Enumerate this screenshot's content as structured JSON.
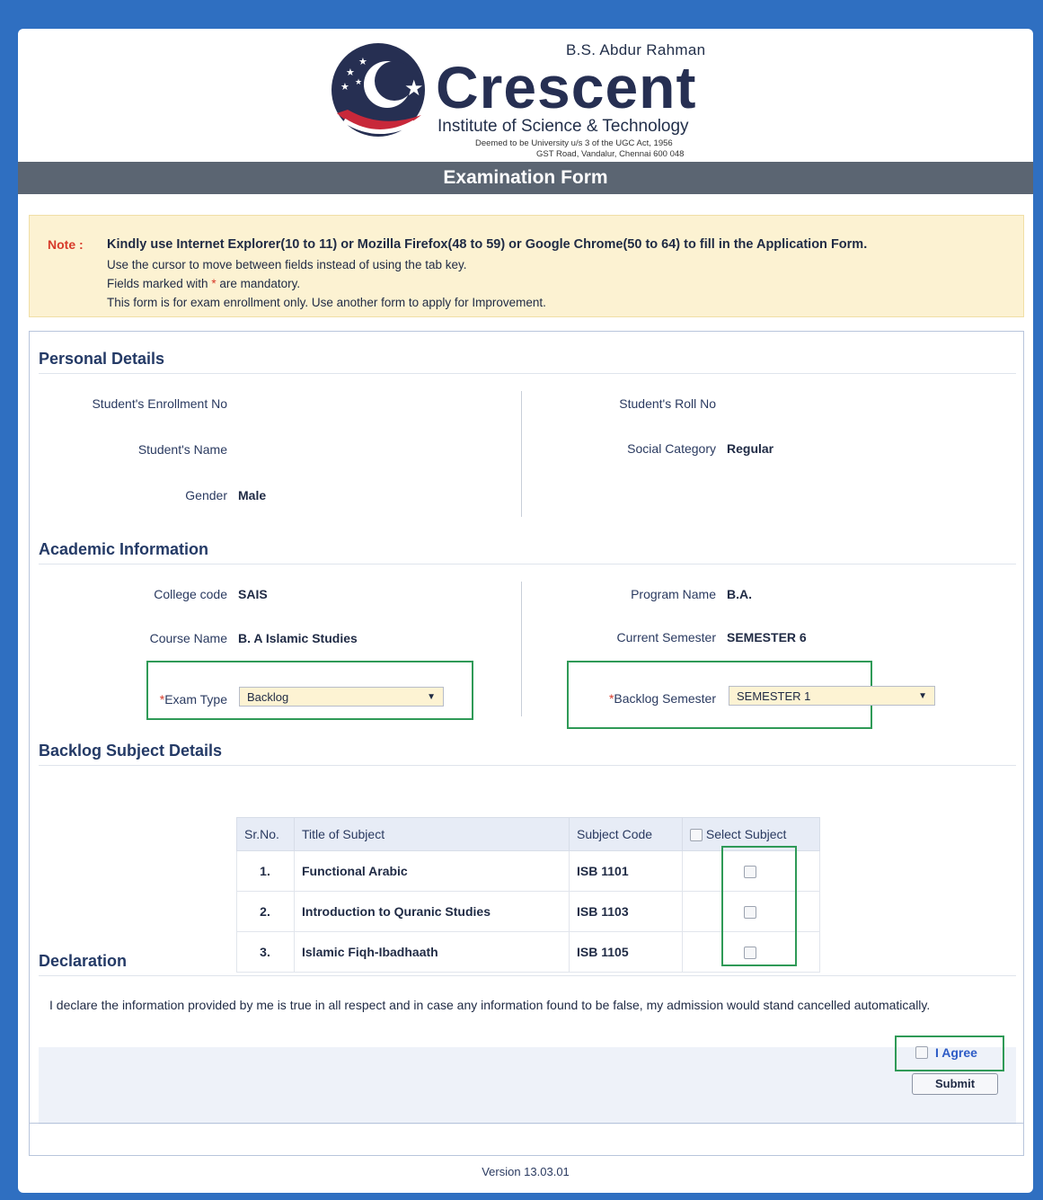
{
  "header": {
    "brand_top": "B.S. Abdur Rahman",
    "brand_name": "Crescent",
    "brand_sub": "Institute of Science & Technology",
    "brand_small1": "Deemed to be University u/s 3 of the UGC Act, 1956",
    "brand_small2": "GST Road, Vandalur, Chennai 600 048",
    "title": "Examination Form"
  },
  "note": {
    "label": "Note :",
    "lines": [
      "Kindly use Internet Explorer(10 to 11) or Mozilla Firefox(48 to 59) or Google Chrome(50 to 64) to fill in the Application Form.",
      "Use the cursor to move between fields instead of using the tab key.",
      "Fields marked with",
      "are mandatory.",
      "This form is for exam enrollment only. Use another form to apply for Improvement."
    ],
    "star": "*"
  },
  "personal": {
    "title": "Personal Details",
    "enrollment_label": "Student's Enrollment No",
    "enrollment_value": "",
    "name_label": "Student's Name",
    "name_value": "",
    "gender_label": "Gender",
    "gender_value": "Male",
    "roll_label": "Student's Roll No",
    "roll_value": "",
    "category_label": "Social Category",
    "category_value": "Regular"
  },
  "academic": {
    "title": "Academic Information",
    "college_label": "College code",
    "college_value": "SAIS",
    "course_label": "Course Name",
    "course_value": "B. A Islamic Studies",
    "program_label": "Program Name",
    "program_value": "B.A.",
    "semester_label": "Current Semester",
    "semester_value": "SEMESTER 6",
    "exam_type_label": "Exam Type",
    "exam_type_value": "Backlog",
    "backlog_sem_label": "Backlog Semester",
    "backlog_sem_value": "SEMESTER 1",
    "star": "*"
  },
  "backlog": {
    "title": "Backlog Subject Details",
    "headers": [
      "Sr.No.",
      "Title of Subject",
      "Subject Code",
      "Select Subject"
    ],
    "rows": [
      {
        "sr": "1.",
        "title": "Functional Arabic",
        "code": "ISB 1101"
      },
      {
        "sr": "2.",
        "title": "Introduction to Quranic Studies",
        "code": "ISB 1103"
      },
      {
        "sr": "3.",
        "title": "Islamic Fiqh-Ibadhaath",
        "code": "ISB 1105"
      }
    ]
  },
  "declaration": {
    "title": "Declaration",
    "text": "I declare the information provided by me is true in all respect and in case any information found to be false, my admission would stand cancelled automatically.",
    "agree_label": "I Agree",
    "submit_label": "Submit"
  },
  "footer": {
    "version": "Version 13.03.01"
  },
  "colors": {
    "background": "#2f6fc1",
    "title_bar": "#5b6572",
    "note_bg": "#fcf2d2",
    "highlight_border": "#2f9a57",
    "required": "#d73a2a"
  }
}
